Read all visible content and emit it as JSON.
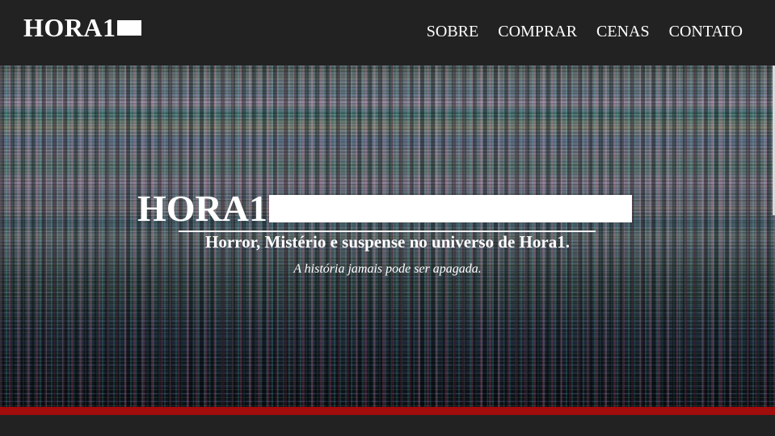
{
  "brand": {
    "name": "HORA1"
  },
  "nav": {
    "items": [
      {
        "label": "SOBRE"
      },
      {
        "label": "COMPRAR"
      },
      {
        "label": "CENAS"
      },
      {
        "label": "CONTATO"
      }
    ]
  },
  "hero": {
    "title": "HORA1",
    "subtitle": "Horror, Mistério e suspense no universo de Hora1.",
    "tagline": "A história jamais pode ser apagada."
  },
  "colors": {
    "background": "#222222",
    "accent_bar": "#a10c0c",
    "text": "#ffffff"
  }
}
